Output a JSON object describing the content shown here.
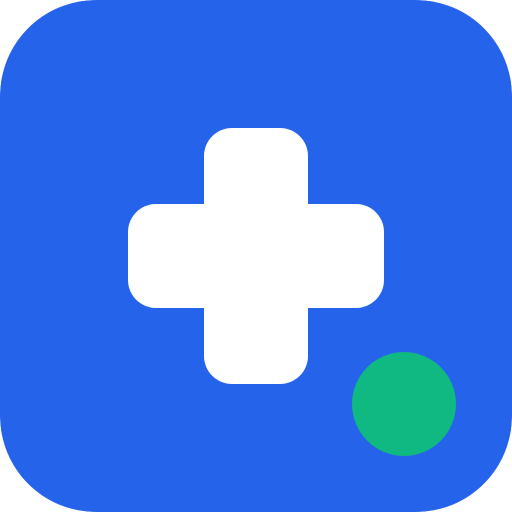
{
  "icon": {
    "name": "medical-cross-app-icon",
    "background_color": "#2563EB",
    "cross_color": "#FFFFFF",
    "status_dot_color": "#10B981",
    "glyphs": [
      "plus-cross-icon",
      "status-dot-icon"
    ]
  }
}
